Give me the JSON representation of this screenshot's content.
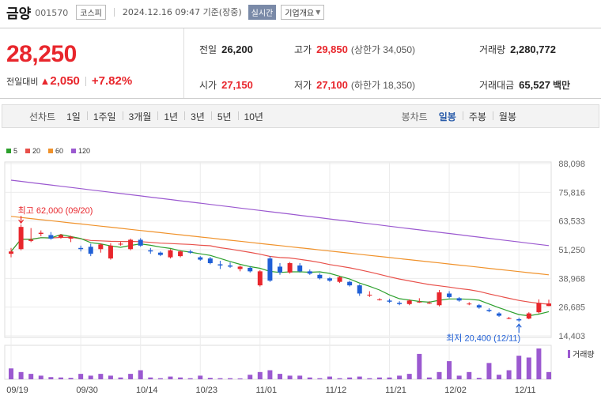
{
  "header": {
    "name": "금양",
    "code": "001570",
    "market": "코스피",
    "datetime": "2024.12.16 09:47 기준(장중)",
    "realtime": "실시간",
    "company_info": "기업개요"
  },
  "price": {
    "current": "28,250",
    "change_label": "전일대비",
    "change_arrow": "▲",
    "change_value": "2,050",
    "change_pct": "+7.82%"
  },
  "stats": {
    "prev_close": {
      "label": "전일",
      "value": "26,200"
    },
    "open": {
      "label": "시가",
      "value": "27,150"
    },
    "high": {
      "label": "고가",
      "value": "29,850",
      "limit": "(상한가 34,050)"
    },
    "low": {
      "label": "저가",
      "value": "27,100",
      "limit": "(하한가 18,350)"
    },
    "volume": {
      "label": "거래량",
      "value": "2,280,772"
    },
    "trade_value": {
      "label": "거래대금",
      "value": "65,527",
      "unit": "백만"
    }
  },
  "period_bar": {
    "line_label": "선차트",
    "periods": [
      "1일",
      "1주일",
      "3개월",
      "1년",
      "3년",
      "5년",
      "10년"
    ],
    "candle_label": "봉차트",
    "candle_periods": [
      "일봉",
      "주봉",
      "월봉"
    ],
    "active_candle": "일봉"
  },
  "legend": [
    {
      "label": "5",
      "color": "#2ca02c"
    },
    {
      "label": "20",
      "color": "#e8504a"
    },
    {
      "label": "60",
      "color": "#f0922b"
    },
    {
      "label": "120",
      "color": "#9b59d0"
    }
  ],
  "chart_data": {
    "type": "candlestick",
    "title": "",
    "y_ticks": [
      "88,098",
      "75,816",
      "63,533",
      "51,250",
      "38,968",
      "26,685",
      "14,403"
    ],
    "ylim": [
      14403,
      88098
    ],
    "x_ticks": [
      "09/19",
      "09/30",
      "10/14",
      "10/23",
      "11/01",
      "11/12",
      "11/21",
      "12/02",
      "12/11"
    ],
    "x_tick_index": [
      0,
      7,
      13,
      19,
      25,
      32,
      38,
      44,
      51
    ],
    "volume_label": "거래량",
    "high_annotation": {
      "text": "최고 62,000 (09/20)",
      "index": 1,
      "value": 62000
    },
    "low_annotation": {
      "text": "최저 20,400 (12/11)",
      "index": 51,
      "value": 20400
    },
    "candles": [
      {
        "o": 49500,
        "h": 52000,
        "l": 48000,
        "c": 50500
      },
      {
        "o": 51500,
        "h": 62000,
        "l": 51000,
        "c": 61000
      },
      {
        "o": 55000,
        "h": 60500,
        "l": 54500,
        "c": 55500
      },
      {
        "o": 58000,
        "h": 59500,
        "l": 57000,
        "c": 58500
      },
      {
        "o": 57500,
        "h": 58800,
        "l": 55500,
        "c": 56000
      },
      {
        "o": 56500,
        "h": 58000,
        "l": 56000,
        "c": 57500
      },
      {
        "o": 56000,
        "h": 57200,
        "l": 54500,
        "c": 56800
      },
      {
        "o": 52000,
        "h": 53000,
        "l": 50500,
        "c": 51500
      },
      {
        "o": 52500,
        "h": 53800,
        "l": 48500,
        "c": 49500
      },
      {
        "o": 51500,
        "h": 54000,
        "l": 50000,
        "c": 53500
      },
      {
        "o": 47500,
        "h": 54000,
        "l": 47000,
        "c": 53000
      },
      {
        "o": 53500,
        "h": 54500,
        "l": 53000,
        "c": 53800
      },
      {
        "o": 51500,
        "h": 56000,
        "l": 51000,
        "c": 55500
      },
      {
        "o": 55500,
        "h": 56200,
        "l": 52500,
        "c": 53000
      },
      {
        "o": 51000,
        "h": 52000,
        "l": 49500,
        "c": 50500
      },
      {
        "o": 50000,
        "h": 50500,
        "l": 48500,
        "c": 49000
      },
      {
        "o": 48000,
        "h": 51500,
        "l": 47500,
        "c": 51000
      },
      {
        "o": 48500,
        "h": 51000,
        "l": 48000,
        "c": 50500
      },
      {
        "o": 50500,
        "h": 51200,
        "l": 49500,
        "c": 50000
      },
      {
        "o": 48000,
        "h": 48500,
        "l": 46500,
        "c": 47000
      },
      {
        "o": 47500,
        "h": 48200,
        "l": 45000,
        "c": 45500
      },
      {
        "o": 45000,
        "h": 46500,
        "l": 43000,
        "c": 44500
      },
      {
        "o": 44500,
        "h": 45800,
        "l": 43500,
        "c": 44000
      },
      {
        "o": 43000,
        "h": 44500,
        "l": 42000,
        "c": 44000
      },
      {
        "o": 43500,
        "h": 44200,
        "l": 41500,
        "c": 42000
      },
      {
        "o": 36000,
        "h": 42500,
        "l": 35500,
        "c": 42000
      },
      {
        "o": 47500,
        "h": 48500,
        "l": 37500,
        "c": 38000
      },
      {
        "o": 44000,
        "h": 45500,
        "l": 40500,
        "c": 41500
      },
      {
        "o": 41500,
        "h": 46000,
        "l": 41000,
        "c": 45500
      },
      {
        "o": 44500,
        "h": 45500,
        "l": 41500,
        "c": 42000
      },
      {
        "o": 42000,
        "h": 42800,
        "l": 40500,
        "c": 41000
      },
      {
        "o": 40500,
        "h": 41200,
        "l": 38500,
        "c": 39000
      },
      {
        "o": 39000,
        "h": 39500,
        "l": 37500,
        "c": 38000
      },
      {
        "o": 37500,
        "h": 40000,
        "l": 37000,
        "c": 39500
      },
      {
        "o": 37500,
        "h": 38000,
        "l": 35500,
        "c": 36000
      },
      {
        "o": 36000,
        "h": 36500,
        "l": 31500,
        "c": 32500
      },
      {
        "o": 32000,
        "h": 33500,
        "l": 31000,
        "c": 32000
      },
      {
        "o": 30000,
        "h": 30500,
        "l": 29500,
        "c": 30000
      },
      {
        "o": 29500,
        "h": 30200,
        "l": 28500,
        "c": 29000
      },
      {
        "o": 28500,
        "h": 29200,
        "l": 27500,
        "c": 28000
      },
      {
        "o": 28000,
        "h": 30000,
        "l": 27500,
        "c": 29500
      },
      {
        "o": 29000,
        "h": 30500,
        "l": 28500,
        "c": 29000
      },
      {
        "o": 28500,
        "h": 29200,
        "l": 28000,
        "c": 28500
      },
      {
        "o": 27500,
        "h": 34000,
        "l": 27000,
        "c": 33000
      },
      {
        "o": 32500,
        "h": 33500,
        "l": 30500,
        "c": 31000
      },
      {
        "o": 30500,
        "h": 31000,
        "l": 29000,
        "c": 29500
      },
      {
        "o": 28000,
        "h": 28800,
        "l": 27500,
        "c": 28200
      },
      {
        "o": 27500,
        "h": 28000,
        "l": 26000,
        "c": 26500
      },
      {
        "o": 25500,
        "h": 26200,
        "l": 24500,
        "c": 25000
      },
      {
        "o": 24000,
        "h": 24500,
        "l": 22500,
        "c": 23000
      },
      {
        "o": 22000,
        "h": 22500,
        "l": 21500,
        "c": 22000
      },
      {
        "o": 21500,
        "h": 22200,
        "l": 20400,
        "c": 21000
      },
      {
        "o": 21800,
        "h": 24500,
        "l": 21500,
        "c": 24000
      },
      {
        "o": 24500,
        "h": 30000,
        "l": 24000,
        "c": 28500
      },
      {
        "o": 27150,
        "h": 29850,
        "l": 27100,
        "c": 28250
      }
    ],
    "volume": [
      6,
      4,
      3,
      2,
      1.2,
      1,
      0.8,
      3,
      2,
      3,
      2,
      1,
      3,
      5,
      1,
      0.6,
      1.5,
      1,
      0.6,
      2,
      0.8,
      0.6,
      0.6,
      0.5,
      2.5,
      4,
      5,
      3,
      2,
      2,
      1,
      0.6,
      1.5,
      0.6,
      1,
      1.5,
      0.6,
      1,
      1,
      2,
      3,
      14,
      1,
      4,
      10,
      2,
      4,
      0.8,
      9,
      2.5,
      5,
      13,
      12,
      17,
      4
    ]
  }
}
